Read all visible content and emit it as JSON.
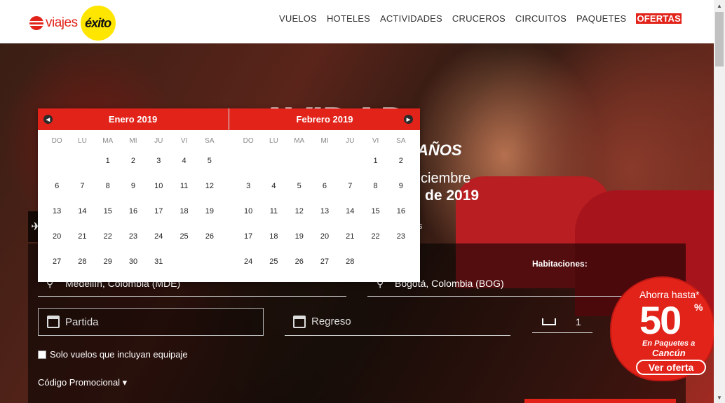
{
  "header": {
    "logo_text": "viajes",
    "logo_brand": "éxito",
    "nav": [
      "VUELOS",
      "HOTELES",
      "ACTIVIDADES",
      "CRUCEROS",
      "CIRCUITOS",
      "PAQUETES",
      "OFERTAS"
    ]
  },
  "hero": {
    "headline": "AVIDAD",
    "sub1": "AÑOS",
    "sub2": "ciembre",
    "sub3": "de 2019"
  },
  "search": {
    "tab_partial": "s",
    "origin": "Medellín, Colombia (MDE)",
    "destination": "Bogotá, Colombia (BOG)",
    "departure_placeholder": "Partida",
    "return_placeholder": "Regreso",
    "rooms_label": "Habitaciones:",
    "rooms_value": "1",
    "baggage_label": "Solo vuelos que incluyan equipaje",
    "promo_label": "Código Promocional ▾"
  },
  "badge": {
    "line1": "Ahorra hasta*",
    "value": "50",
    "percent": "%",
    "line2": "En Paquetes a",
    "line3": "Cancún",
    "button": "Ver oferta"
  },
  "calendar": {
    "weekdays": [
      "DO",
      "LU",
      "MA",
      "MI",
      "JU",
      "VI",
      "SA"
    ],
    "months": [
      {
        "title": "Enero 2019",
        "days": [
          "",
          "",
          "1",
          "2",
          "3",
          "4",
          "5",
          "6",
          "7",
          "8",
          "9",
          "10",
          "11",
          "12",
          "13",
          "14",
          "15",
          "16",
          "17",
          "18",
          "19",
          "20",
          "21",
          "22",
          "23",
          "24",
          "25",
          "26",
          "27",
          "28",
          "29",
          "30",
          "31",
          "",
          ""
        ]
      },
      {
        "title": "Febrero 2019",
        "days": [
          "",
          "",
          "",
          "",
          "",
          "1",
          "2",
          "3",
          "4",
          "5",
          "6",
          "7",
          "8",
          "9",
          "10",
          "11",
          "12",
          "13",
          "14",
          "15",
          "16",
          "17",
          "18",
          "19",
          "20",
          "21",
          "22",
          "23",
          "24",
          "25",
          "26",
          "27",
          "28",
          "",
          ""
        ]
      }
    ]
  },
  "colors": {
    "brand_red": "#e2231a",
    "brand_yellow": "#ffe600"
  }
}
